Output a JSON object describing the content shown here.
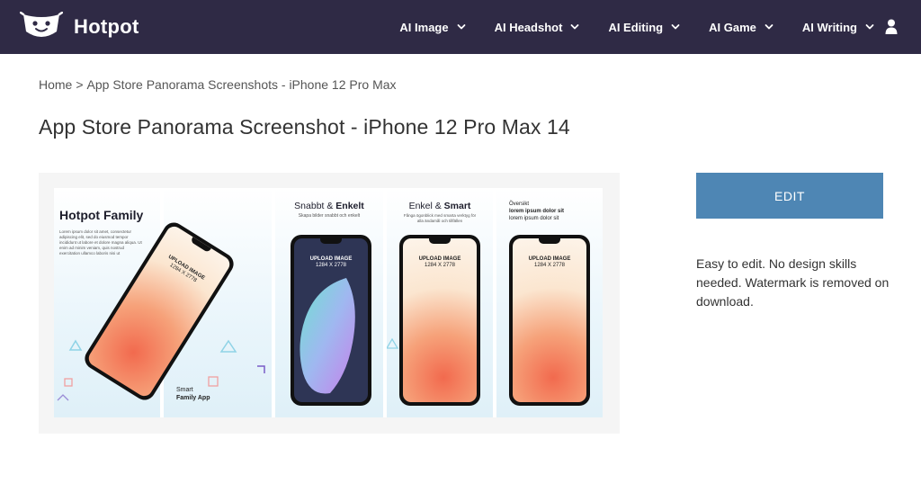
{
  "brand": {
    "name": "Hotpot"
  },
  "nav": {
    "items": [
      {
        "label": "AI Image"
      },
      {
        "label": "AI Headshot"
      },
      {
        "label": "AI Editing"
      },
      {
        "label": "AI Game"
      },
      {
        "label": "AI Writing"
      }
    ]
  },
  "breadcrumb": {
    "home": "Home",
    "separator": ">",
    "current": "App Store Panorama Screenshots - iPhone 12 Pro Max"
  },
  "page": {
    "title": "App Store Panorama Screenshot - iPhone 12 Pro Max 14"
  },
  "preview": {
    "panel1": {
      "title": "Hotpot Family",
      "body": "Lorem ipsum dolor sit amet, consectetur adipiscing elit, sed do eiusmod tempor incididunt ut labore et dolore magna aliqua. Ut enim ad minim veniam, quis nostrud exercitation ullamco laboris nisi ut",
      "upload_line1": "UPLOAD IMAGE",
      "upload_line2": "1284 X 2778",
      "footer_line1": "Smart",
      "footer_line2": "Family App"
    },
    "panel3": {
      "title_normal": "Snabbt & ",
      "title_bold": "Enkelt",
      "sub": "Skapa bilder snabbt och enkelt",
      "upload_line1": "UPLOAD IMAGE",
      "upload_line2": "1284 X 2778"
    },
    "panel4": {
      "title_normal": "Enkel & ",
      "title_bold": "Smart",
      "sub": "Fånga ögonblick med smarta verktyg för alla ändamål och tillfällen",
      "upload_line1": "UPLOAD IMAGE",
      "upload_line2": "1284 X 2778"
    },
    "panel5": {
      "line1": "Översikt",
      "line2": "lorem ipsum dolor sit",
      "line3": "lorem ipsum dolor sit",
      "upload_line1": "UPLOAD IMAGE",
      "upload_line2": "1284 X 2778"
    }
  },
  "sidebar": {
    "edit_label": "EDIT",
    "description": "Easy to edit. No design skills needed. Watermark is removed on download."
  },
  "colors": {
    "navbar": "#2f2a45",
    "edit_button": "#4e86b4",
    "accent_orange": "#f07a5a"
  }
}
